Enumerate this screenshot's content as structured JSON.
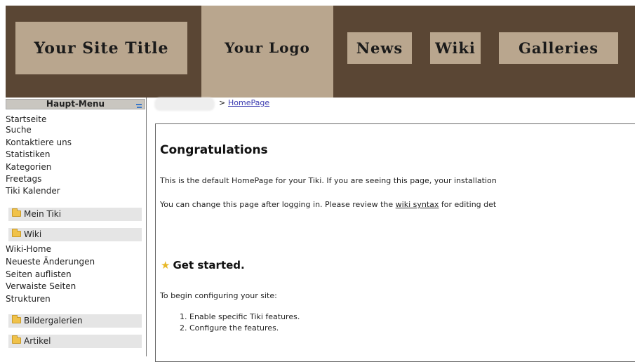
{
  "header": {
    "site_title": "Your Site Title",
    "logo": "Your Logo",
    "nav": [
      "News",
      "Wiki",
      "Galleries"
    ]
  },
  "sidebar": {
    "menu_title": "Haupt-Menu",
    "top_items": [
      "Startseite",
      "Suche",
      "Kontaktiere uns",
      "Statistiken",
      "Kategorien",
      "Freetags",
      "Tiki Kalender"
    ],
    "sections": [
      "Mein Tiki",
      "Wiki",
      "Bildergalerien",
      "Artikel"
    ],
    "wiki_items": [
      "Wiki-Home",
      "Neueste Änderungen",
      "Seiten auflisten",
      "Verwaiste Seiten",
      "Strukturen"
    ]
  },
  "breadcrumb": {
    "separator": ">",
    "current": "HomePage"
  },
  "content": {
    "heading": "Congratulations",
    "intro": "This is the default HomePage for your Tiki. If you are seeing this page, your installation",
    "change_prefix": "You can change this page after logging in. Please review the ",
    "change_link": "wiki syntax",
    "change_suffix": " for editing det",
    "subheading": "Get started.",
    "begin": "To begin configuring your site:",
    "steps": [
      "Enable specific Tiki features.",
      "Configure the features."
    ]
  },
  "colors": {
    "header_bg": "#5a4634",
    "header_box": "#b9a68e",
    "link": "#3a3ab0"
  },
  "icons": [
    "menu-toggle-icon",
    "folder-icon",
    "star-icon"
  ]
}
